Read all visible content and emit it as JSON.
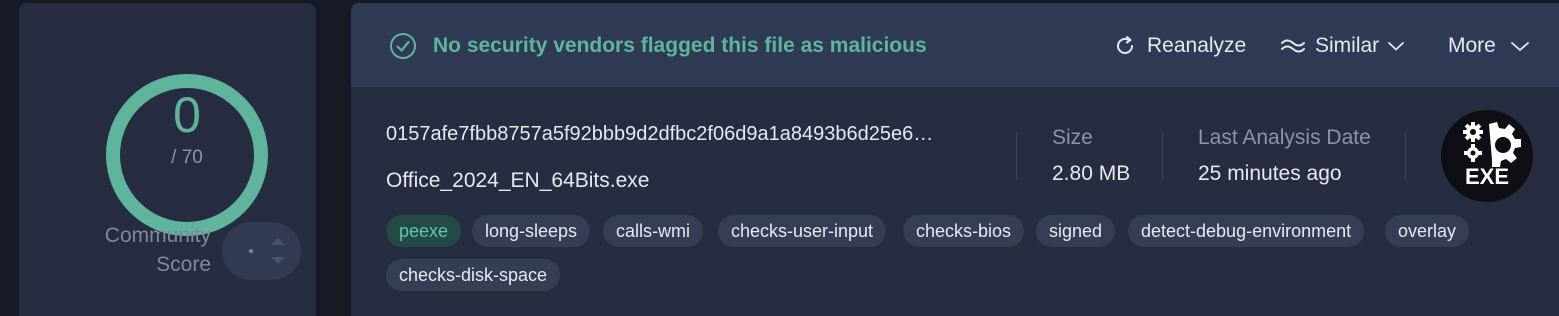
{
  "community_score": {
    "value": "0",
    "total": "/ 70",
    "label_line1": "Community",
    "label_line2": "Score",
    "ring_color": "#5fb59b"
  },
  "banner": {
    "status_text": "No security vendors flagged this file as malicious",
    "status_color": "#5fb59b",
    "icon": "check-circle-icon"
  },
  "actions": {
    "reanalyze": "Reanalyze",
    "similar": "Similar",
    "more": "More"
  },
  "file": {
    "hash": "0157afe7fbb8757a5f92bbb9d2dfbc2f06d9a1a8493b6d25e6…",
    "name": "Office_2024_EN_64Bits.exe",
    "size_label": "Size",
    "size_value": "2.80 MB",
    "last_analysis_label": "Last Analysis Date",
    "last_analysis_value": "25 minutes ago",
    "type_badge": "EXE"
  },
  "tags": [
    "peexe",
    "long-sleeps",
    "calls-wmi",
    "checks-user-input",
    "checks-bios",
    "signed",
    "detect-debug-environment",
    "overlay",
    "checks-disk-space"
  ]
}
